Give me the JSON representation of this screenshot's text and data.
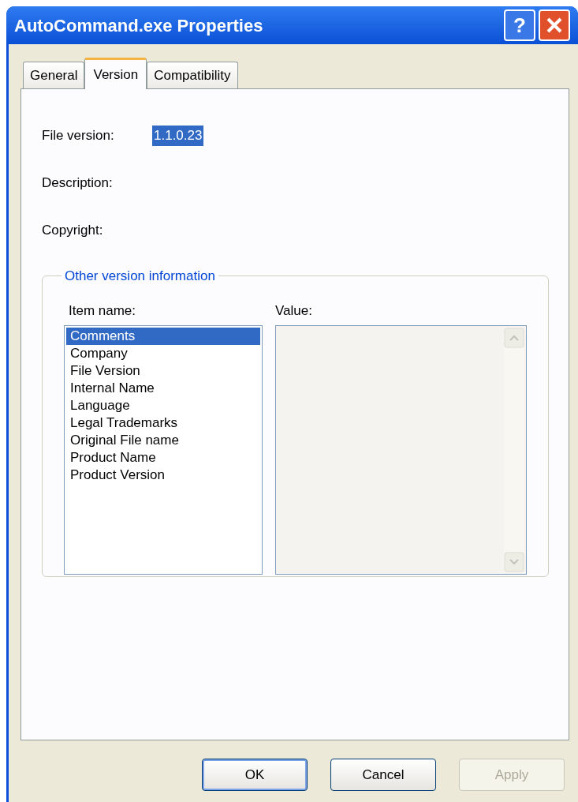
{
  "window": {
    "title": "AutoCommand.exe Properties",
    "help": "?"
  },
  "tabs": [
    {
      "label": "General",
      "selected": false
    },
    {
      "label": "Version",
      "selected": true
    },
    {
      "label": "Compatibility",
      "selected": false
    }
  ],
  "fields": [
    {
      "label": "File version:",
      "value": "1.1.0.23",
      "selected": true
    },
    {
      "label": "Description:"
    },
    {
      "label": "Copyright:"
    }
  ],
  "group": {
    "title": "Other version information",
    "item_label": "Item name:",
    "value_label": "Value:",
    "items": [
      {
        "label": "Comments",
        "selected": true
      },
      {
        "label": "Company",
        "selected": false
      },
      {
        "label": "File Version",
        "selected": false
      },
      {
        "label": "Internal Name",
        "selected": false
      },
      {
        "label": "Language",
        "selected": false
      },
      {
        "label": "Legal Trademarks",
        "selected": false
      },
      {
        "label": "Original File name",
        "selected": false
      },
      {
        "label": "Product Name",
        "selected": false
      },
      {
        "label": "Product Version",
        "selected": false
      }
    ]
  },
  "buttons": [
    {
      "label": "OK",
      "disabled": false,
      "default": true
    },
    {
      "label": "Cancel",
      "disabled": false,
      "default": false
    },
    {
      "label": "Apply",
      "disabled": true,
      "default": false
    }
  ]
}
